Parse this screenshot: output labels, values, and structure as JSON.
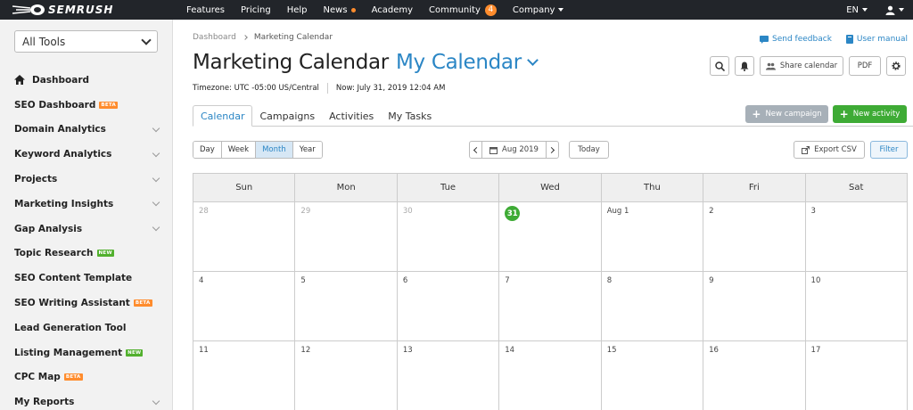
{
  "topnav": {
    "logo_text": "SEMRUSH",
    "items": [
      {
        "label": "Features"
      },
      {
        "label": "Pricing"
      },
      {
        "label": "Help"
      },
      {
        "label": "News"
      },
      {
        "label": "Academy"
      },
      {
        "label": "Community",
        "badge": "4"
      },
      {
        "label": "Company"
      }
    ],
    "language": "EN"
  },
  "sidebar": {
    "tools_select": "All Tools",
    "items": [
      {
        "label": "Dashboard"
      },
      {
        "label": "SEO Dashboard",
        "badge": "BETA"
      },
      {
        "label": "Domain Analytics"
      },
      {
        "label": "Keyword Analytics"
      },
      {
        "label": "Projects"
      },
      {
        "label": "Marketing Insights"
      },
      {
        "label": "Gap Analysis"
      },
      {
        "label": "Topic Research",
        "badge": "NEW"
      },
      {
        "label": "SEO Content Template"
      },
      {
        "label": "SEO Writing Assistant",
        "badge": "BETA"
      },
      {
        "label": "Lead Generation Tool"
      },
      {
        "label": "Listing Management",
        "badge": "NEW"
      },
      {
        "label": "CPC Map",
        "badge": "BETA"
      },
      {
        "label": "My Reports"
      }
    ]
  },
  "breadcrumb": {
    "root": "Dashboard",
    "current": "Marketing Calendar"
  },
  "top_links": {
    "feedback": "Send feedback",
    "manual": "User manual"
  },
  "header": {
    "title": "Marketing Calendar",
    "calendar_name": "My Calendar",
    "timezone": "Timezone: UTC -05:00 US/Central",
    "now": "Now: July 31, 2019 12:04 AM",
    "share_label": "Share calendar",
    "pdf_label": "PDF"
  },
  "tabs": [
    {
      "label": "Calendar"
    },
    {
      "label": "Campaigns"
    },
    {
      "label": "Activities"
    },
    {
      "label": "My Tasks"
    }
  ],
  "actions": {
    "new_campaign": "New campaign",
    "new_activity": "New activity"
  },
  "controls": {
    "views": [
      "Day",
      "Week",
      "Month",
      "Year"
    ],
    "active_view": "Month",
    "month_label": "Aug 2019",
    "today": "Today",
    "export": "Export CSV",
    "filter": "Filter"
  },
  "calendar": {
    "weekdays": [
      "Sun",
      "Mon",
      "Tue",
      "Wed",
      "Thu",
      "Fri",
      "Sat"
    ],
    "weeks": [
      [
        "28",
        "29",
        "30",
        "31",
        "Aug 1",
        "2",
        "3"
      ],
      [
        "4",
        "5",
        "6",
        "7",
        "8",
        "9",
        "10"
      ],
      [
        "11",
        "12",
        "13",
        "14",
        "15",
        "16",
        "17"
      ]
    ]
  },
  "colors": {
    "accent_blue": "#2b86c5",
    "green": "#3eab35",
    "orange": "#ff8c2d",
    "nav_bg": "#22252a"
  }
}
